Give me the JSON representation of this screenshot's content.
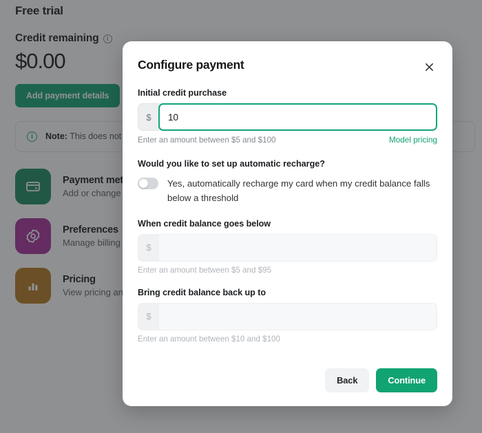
{
  "background": {
    "title": "Free trial",
    "credit_label": "Credit remaining",
    "credit_info_icon": "info-icon",
    "credit_amount": "$0.00",
    "add_payment_button": "Add payment details",
    "note": {
      "icon": "info-icon",
      "bold_prefix": "Note:",
      "text": "This does not"
    },
    "tiles": [
      {
        "title": "Payment met",
        "subtitle": "Add or change",
        "icon": "credit-card-icon",
        "color": "#1a8a5f"
      },
      {
        "title": "Preferences",
        "subtitle": "Manage billing",
        "icon": "gear-icon",
        "color": "#a62f99"
      },
      {
        "title": "Pricing",
        "subtitle": "View pricing an",
        "icon": "bar-chart-icon",
        "color": "#b5781f"
      }
    ]
  },
  "modal": {
    "title": "Configure payment",
    "close_icon": "close-icon",
    "initial_purchase": {
      "label": "Initial credit purchase",
      "currency_prefix": "$",
      "value": "10",
      "placeholder": "",
      "help_text": "Enter an amount between $5 and $100",
      "help_link": "Model pricing"
    },
    "recharge": {
      "question": "Would you like to set up automatic recharge?",
      "toggle_state": "off",
      "toggle_label": "Yes, automatically recharge my card when my credit balance falls below a threshold"
    },
    "threshold": {
      "label": "When credit balance goes below",
      "currency_prefix": "$",
      "value": "",
      "placeholder": "",
      "help_text": "Enter an amount between $5 and $95"
    },
    "topup": {
      "label": "Bring credit balance back up to",
      "currency_prefix": "$",
      "value": "",
      "placeholder": "",
      "help_text": "Enter an amount between $10 and $100"
    },
    "footer": {
      "back_label": "Back",
      "continue_label": "Continue"
    }
  },
  "colors": {
    "accent_green": "#12a373",
    "focus_green": "#12a37c",
    "overlay": "#808080"
  }
}
